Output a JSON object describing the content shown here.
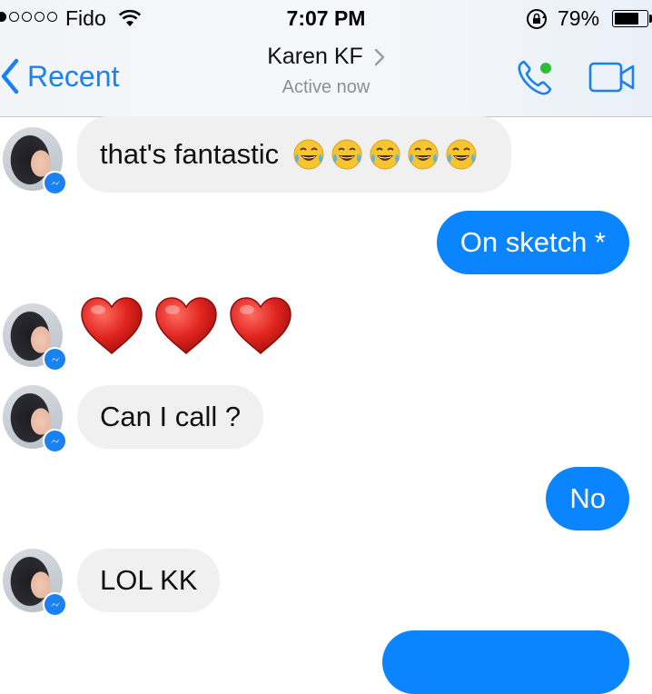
{
  "status_bar": {
    "carrier": "Fido",
    "time": "7:07 PM",
    "battery_percent": "79%",
    "battery_level": 0.79,
    "signal_bars_filled": 1,
    "signal_bars_total": 5
  },
  "nav": {
    "back_label": "Recent",
    "contact_name": "Karen KF",
    "presence": "Active now",
    "accent_color": "#1a82f0",
    "online_dot_color": "#2dbd3a"
  },
  "messages": [
    {
      "sender": "contact",
      "text": "that's fantastic",
      "emoji_count": 5,
      "emoji": "face-with-tears-of-joy"
    },
    {
      "sender": "me",
      "text": "On sketch *"
    },
    {
      "sender": "contact",
      "type": "emoji",
      "emoji": "red-heart",
      "emoji_count": 3
    },
    {
      "sender": "contact",
      "text": "Can I call ?"
    },
    {
      "sender": "me",
      "text": "No"
    },
    {
      "sender": "contact",
      "text": "LOL KK"
    },
    {
      "sender": "me",
      "text": ""
    }
  ],
  "colors": {
    "outgoing_bubble": "#0a84ff",
    "incoming_bubble": "#f0f0f0",
    "messenger_badge": "#1a82f0",
    "heart": "#e0241f"
  }
}
